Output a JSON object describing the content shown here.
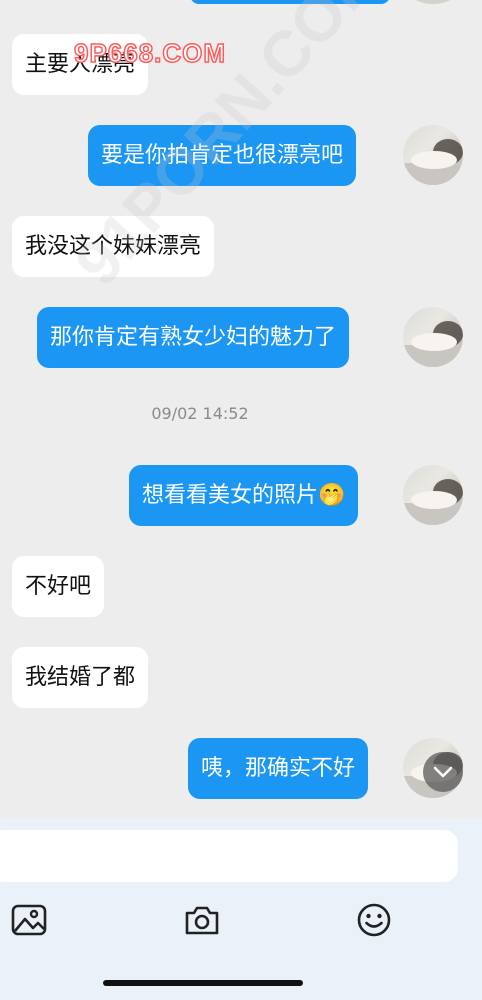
{
  "watermarks": {
    "top": "9P668.COM",
    "diagonal": "91PORN.COM"
  },
  "messages": [
    {
      "side": "in",
      "text": "主要人漂亮"
    },
    {
      "side": "out",
      "text": "要是你拍肯定也很漂亮吧"
    },
    {
      "side": "in",
      "text": "我没这个妹妹漂亮"
    },
    {
      "side": "out",
      "text": "那你肯定有熟女少妇的魅力了"
    },
    {
      "side": "out",
      "text": "想看看美女的照片🤭"
    },
    {
      "side": "in",
      "text": "不好吧"
    },
    {
      "side": "in",
      "text": "我结婚了都"
    },
    {
      "side": "out",
      "text": "咦，那确实不好"
    }
  ],
  "timestamp": "09/02 14:52",
  "input": {
    "placeholder": "",
    "value": ""
  },
  "toolbar": {
    "icons": [
      "image-icon",
      "camera-icon",
      "emoji-icon"
    ]
  },
  "colors": {
    "outgoing_bubble": "#1b96f3",
    "incoming_bubble": "#ffffff",
    "background": "#ededed"
  }
}
